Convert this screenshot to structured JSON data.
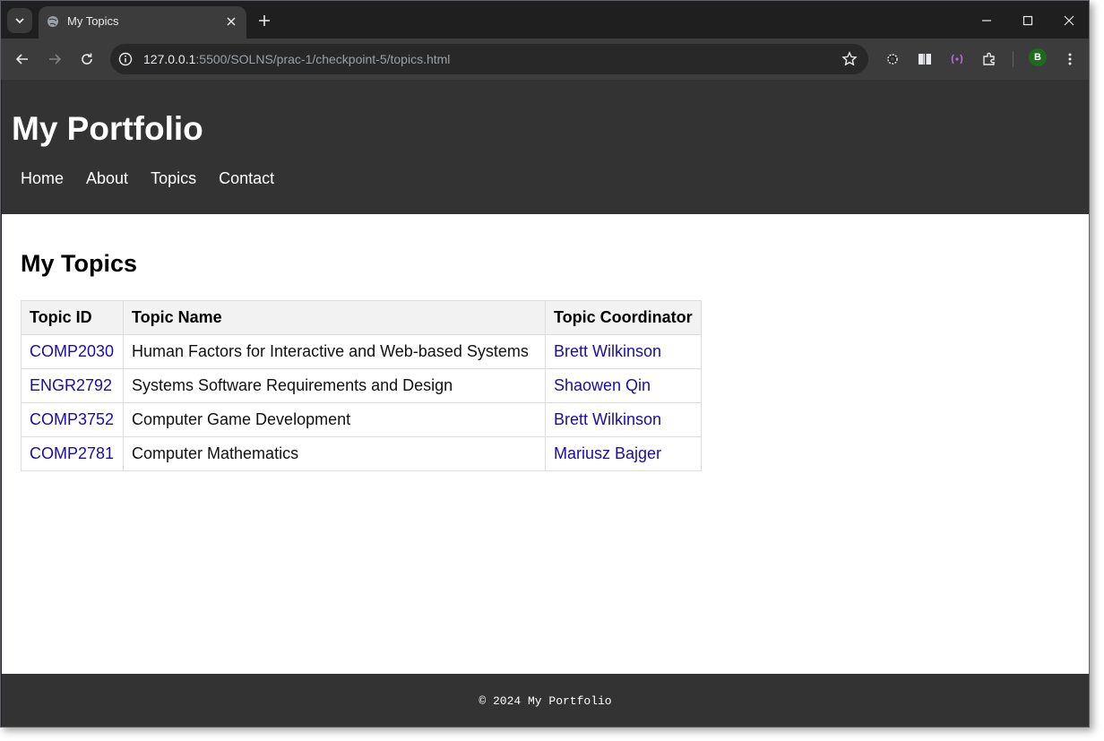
{
  "browser": {
    "tab_title": "My Topics",
    "url_host": "127.0.0.1",
    "url_rest": ":5500/SOLNS/prac-1/checkpoint-5/topics.html",
    "profile_initial": "B"
  },
  "site": {
    "title": "My Portfolio",
    "nav": [
      {
        "label": "Home"
      },
      {
        "label": "About"
      },
      {
        "label": "Topics"
      },
      {
        "label": "Contact"
      }
    ]
  },
  "main": {
    "heading": "My Topics",
    "table": {
      "headers": [
        "Topic ID",
        "Topic Name",
        "Topic Coordinator"
      ],
      "rows": [
        {
          "id": "COMP2030",
          "name": "Human Factors for Interactive and Web-based Systems",
          "coordinator": "Brett Wilkinson"
        },
        {
          "id": "ENGR2792",
          "name": "Systems Software Requirements and Design",
          "coordinator": "Shaowen Qin"
        },
        {
          "id": "COMP3752",
          "name": "Computer Game Development",
          "coordinator": "Brett Wilkinson"
        },
        {
          "id": "COMP2781",
          "name": "Computer Mathematics",
          "coordinator": "Mariusz Bajger"
        }
      ]
    }
  },
  "footer": {
    "text": "© 2024 My Portfolio"
  },
  "colors": {
    "header_bg": "#333333",
    "link": "#1a0dab",
    "table_header_bg": "#f2f2f2"
  }
}
